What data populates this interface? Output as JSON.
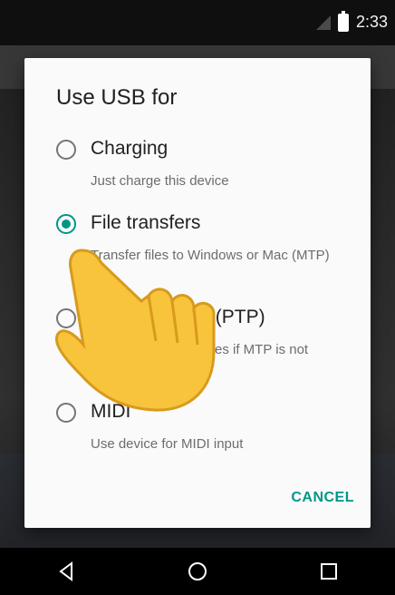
{
  "status_bar": {
    "time": "2:33"
  },
  "dialog": {
    "title": "Use USB for",
    "options": [
      {
        "label": "Charging",
        "description": "Just charge this device",
        "selected": false
      },
      {
        "label": "File transfers",
        "description": "Transfer files to Windows or Mac (MTP)",
        "selected": true
      },
      {
        "label": "Photo transfer (PTP)",
        "description": "Transfer photos or files if MTP is not supported (PTP)",
        "selected": false
      },
      {
        "label": "MIDI",
        "description": "Use device for MIDI input",
        "selected": false
      }
    ],
    "cancel_label": "CANCEL"
  },
  "colors": {
    "accent": "#009688"
  }
}
